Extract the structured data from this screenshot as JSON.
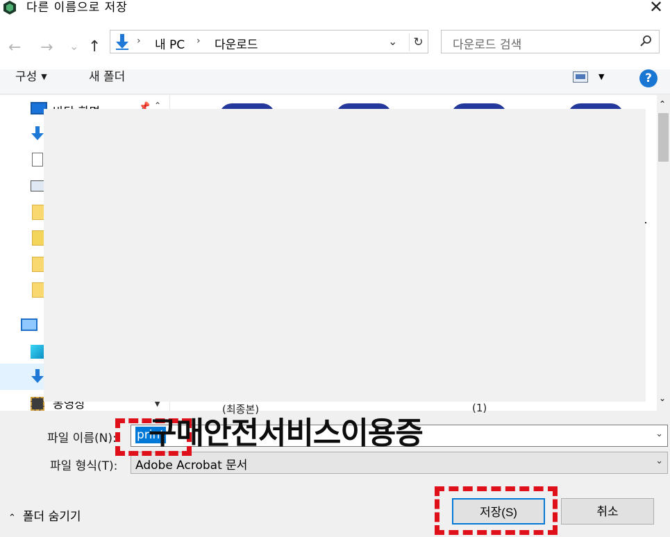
{
  "window": {
    "title": "다른 이름으로 저장",
    "close_glyph": "✕"
  },
  "nav": {
    "back_glyph": "←",
    "forward_glyph": "→",
    "recent_glyph": "⌄",
    "up_glyph": "↑",
    "breadcrumb": [
      "내 PC",
      "다운로드"
    ],
    "separator": "›",
    "dropdown_glyph": "⌄",
    "refresh_glyph": "↻",
    "search_placeholder": "다운로드 검색"
  },
  "toolbar": {
    "organize": "구성",
    "new_folder": "새 폴더",
    "help": "?"
  },
  "nav_pane": {
    "items": [
      {
        "label": "바탕 화면",
        "icon": "desktop-icon"
      },
      {
        "label": "",
        "icon": "download-icon"
      },
      {
        "label": "",
        "icon": "document-icon"
      },
      {
        "label": "",
        "icon": "picture-icon"
      },
      {
        "label": "",
        "icon": "folder-icon"
      },
      {
        "label": "",
        "icon": "network-folder-icon"
      },
      {
        "label": "",
        "icon": "folder-icon"
      },
      {
        "label": "",
        "icon": "folder-icon"
      },
      {
        "label": "",
        "icon": "this-pc-icon"
      },
      {
        "label": "",
        "icon": "3d-objects-icon"
      },
      {
        "label": "",
        "icon": "download-icon"
      },
      {
        "label": "동영상",
        "icon": "video-icon"
      }
    ]
  },
  "files": {
    "labels": [
      "(최종본)",
      "(1)"
    ]
  },
  "form": {
    "filename_label": "파일 이름(N):",
    "filename_value": "print",
    "filetype_label": "파일 형식(T):",
    "filetype_value": "Adobe Acrobat 문서"
  },
  "footer": {
    "hide_folders": "폴더 숨기기",
    "save": "저장(S)",
    "cancel": "취소"
  },
  "annotation": {
    "text": "구매안전서비스이용증",
    "highlight_color": "#e0101a"
  },
  "colors": {
    "accent": "#0078d7",
    "help": "#1976d2"
  }
}
